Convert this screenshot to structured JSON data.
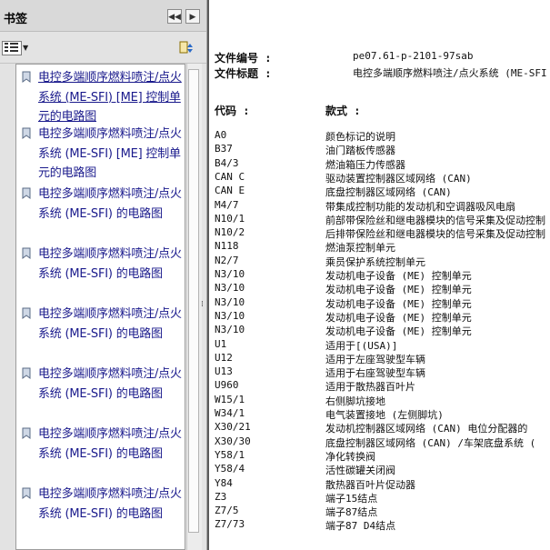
{
  "panel": {
    "title": "书签",
    "collapse_glyph": "◀◀",
    "close_glyph": "▶",
    "bookmarks": [
      {
        "text": "电控多端顺序燃料喷注/点火系统 (ME-SFI) [ME] 控制单元的电路图"
      },
      {
        "text": "电控多端顺序燃料喷注/点火系统 (ME-SFI) [ME] 控制单元的电路图"
      },
      {
        "text": "电控多端顺序燃料喷注/点火系统 (ME-SFI) 的电路图"
      },
      {
        "text": "电控多端顺序燃料喷注/点火系统 (ME-SFI) 的电路图"
      },
      {
        "text": "电控多端顺序燃料喷注/点火系统 (ME-SFI) 的电路图"
      },
      {
        "text": "电控多端顺序燃料喷注/点火系统 (ME-SFI) 的电路图"
      },
      {
        "text": "电控多端顺序燃料喷注/点火系统 (ME-SFI) 的电路图"
      },
      {
        "text": "电控多端顺序燃料喷注/点火系统 (ME-SFI) 的电路图"
      }
    ]
  },
  "document": {
    "file_no_label": "文件编号 :",
    "file_no_value": "pe07.61-p-2101-97sab",
    "file_title_label": "文件标题 :",
    "file_title_value": "电控多端顺序燃料喷注/点火系统 (ME-SFI",
    "code_header": "代码 :",
    "item_header": "款式 :",
    "rows": [
      {
        "code": "A0",
        "name": "颜色标记的说明"
      },
      {
        "code": "B37",
        "name": "油门踏板传感器"
      },
      {
        "code": "B4/3",
        "name": "燃油箱压力传感器"
      },
      {
        "code": "CAN C",
        "name": "驱动装置控制器区域网络 (CAN)"
      },
      {
        "code": "CAN E",
        "name": "底盘控制器区域网络 (CAN)"
      },
      {
        "code": "M4/7",
        "name": "带集成控制功能的发动机和空调器吸风电扇"
      },
      {
        "code": "N10/1",
        "name": "前部带保险丝和继电器模块的信号采集及促动控制"
      },
      {
        "code": "N10/2",
        "name": "后排带保险丝和继电器模块的信号采集及促动控制"
      },
      {
        "code": "N118",
        "name": "燃油泵控制单元"
      },
      {
        "code": "N2/7",
        "name": "乘员保护系统控制单元"
      },
      {
        "code": "N3/10",
        "name": "发动机电子设备 (ME) 控制单元"
      },
      {
        "code": "N3/10",
        "name": "发动机电子设备 (ME) 控制单元"
      },
      {
        "code": "N3/10",
        "name": "发动机电子设备 (ME) 控制单元"
      },
      {
        "code": "N3/10",
        "name": "发动机电子设备 (ME) 控制单元"
      },
      {
        "code": "N3/10",
        "name": "发动机电子设备 (ME) 控制单元"
      },
      {
        "code": "U1",
        "name": "适用于[(USA)]"
      },
      {
        "code": "U12",
        "name": "适用于左座驾驶型车辆"
      },
      {
        "code": "U13",
        "name": "适用于右座驾驶型车辆"
      },
      {
        "code": "U960",
        "name": "适用于散热器百叶片"
      },
      {
        "code": "W15/1",
        "name": "右侧脚坑接地"
      },
      {
        "code": "W34/1",
        "name": "电气装置接地 (左侧脚坑)"
      },
      {
        "code": "X30/21",
        "name": "发动机控制器区域网络 (CAN) 电位分配器的"
      },
      {
        "code": "X30/30",
        "name": "底盘控制器区域网络 (CAN) /车架底盘系统 ("
      },
      {
        "code": "Y58/1",
        "name": "净化转换阀"
      },
      {
        "code": "Y58/4",
        "name": "活性碳罐关闭阀"
      },
      {
        "code": "Y84",
        "name": "散热器百叶片促动器"
      },
      {
        "code": "Z3",
        "name": "端子15结点"
      },
      {
        "code": "Z7/5",
        "name": "端子87结点"
      },
      {
        "code": "Z7/73",
        "name": "端子87 D4结点"
      }
    ]
  }
}
